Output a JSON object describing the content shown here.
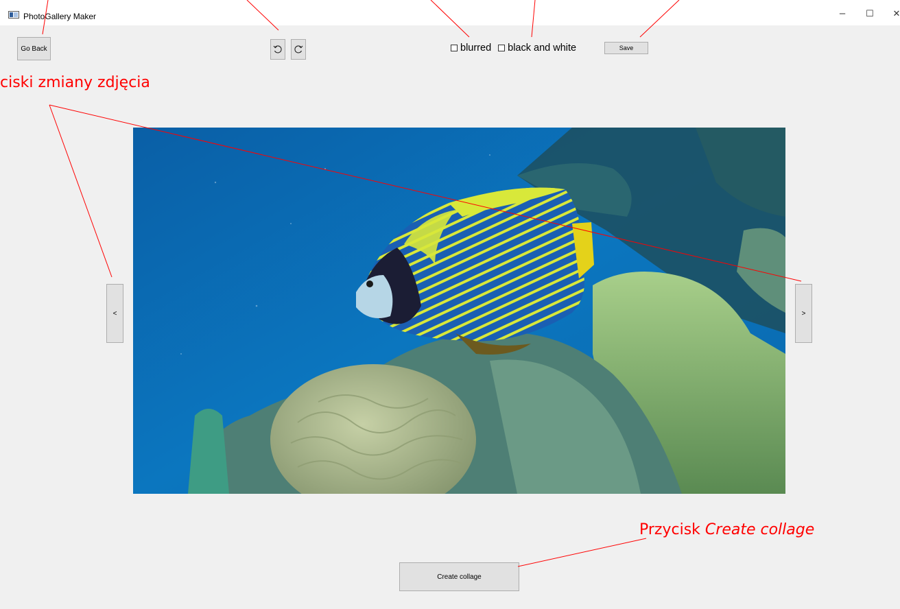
{
  "window": {
    "title": "PhotoGallery Maker",
    "minimize_glyph": "–",
    "maximize_glyph": "☐",
    "close_glyph": "✕"
  },
  "toolbar": {
    "go_back_label": "Go Back",
    "rotate_left_icon": "rotate-left-icon",
    "rotate_right_icon": "rotate-right-icon",
    "blurred_label": "blurred",
    "blurred_checked": false,
    "bw_label": "black and white",
    "bw_checked": false,
    "save_label": "Save"
  },
  "navigation": {
    "prev_label": "<",
    "next_label": ">"
  },
  "footer": {
    "create_collage_label": "Create collage"
  },
  "annotations": {
    "nav_buttons": "ciski zmiany zdjęcia",
    "collage_prefix": "Przycisk ",
    "collage_italic": "Create collage"
  },
  "colors": {
    "annotation": "#ff0000",
    "background": "#f0f0f0",
    "button": "#e1e1e1",
    "button_border": "#adadad"
  }
}
